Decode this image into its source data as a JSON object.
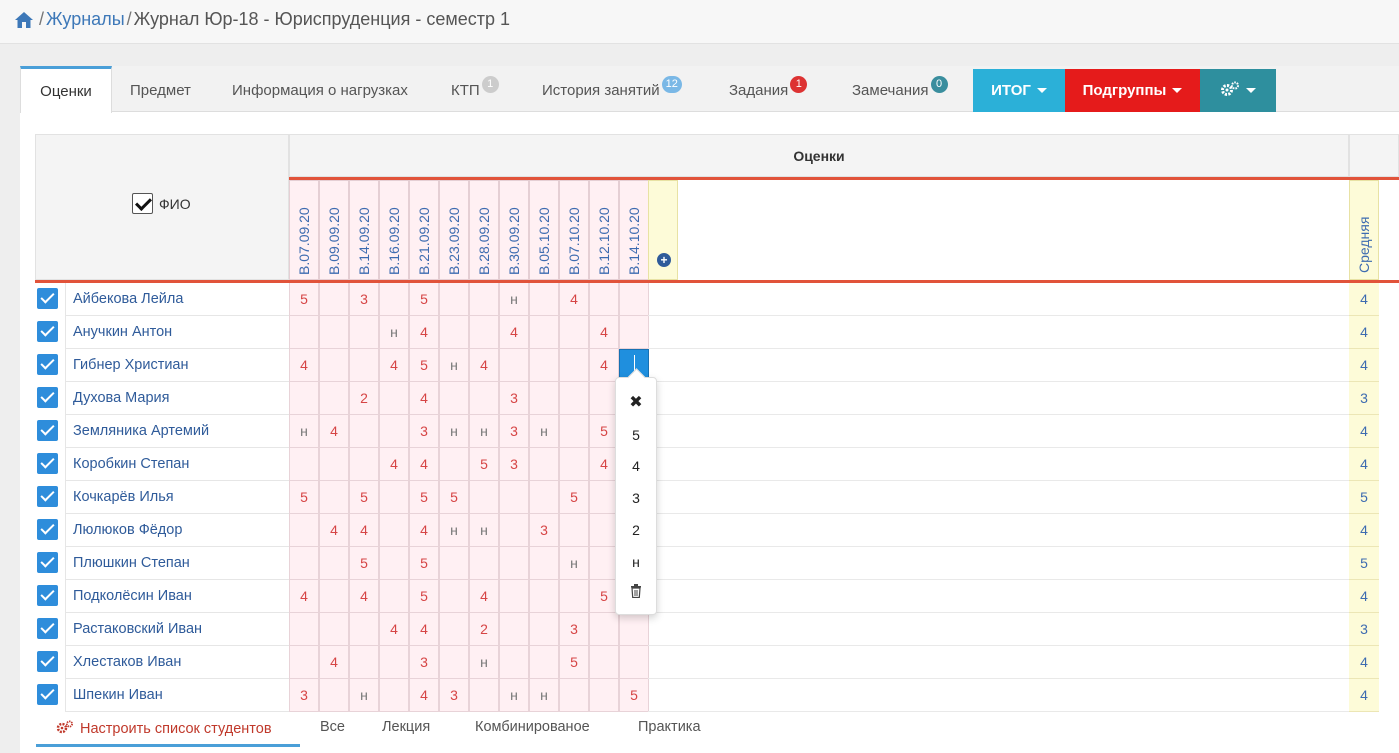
{
  "breadcrumb": {
    "home_icon": "home-icon",
    "journals": "Журналы",
    "current": "Журнал Юр-18 - Юриспруденция - семестр 1"
  },
  "tabs": [
    {
      "label": "Оценки",
      "active": true
    },
    {
      "label": "Предмет"
    },
    {
      "label": "Информация о нагрузках"
    },
    {
      "label": "КТП",
      "badge": "1",
      "badge_color": "#cccccc"
    },
    {
      "label": "История занятий",
      "badge": "12",
      "badge_color": "#7ab8e6"
    },
    {
      "label": "Задания",
      "badge": "1",
      "badge_color": "#dd3333"
    },
    {
      "label": "Замечания",
      "badge": "0",
      "badge_color": "#3a8e9e"
    }
  ],
  "buttons": {
    "itog": {
      "label": "ИТОГ",
      "color": "#2bb0d8"
    },
    "subgroups": {
      "label": "Подгруппы",
      "color": "#e51b1b"
    },
    "settings": {
      "icon": "gears-icon",
      "color": "#2e8f9e"
    }
  },
  "table": {
    "section_title": "Оценки",
    "fio_label": "ФИО",
    "dates": [
      "В.07.09.20",
      "В.09.09.20",
      "В.14.09.20",
      "В.16.09.20",
      "В.21.09.20",
      "В.23.09.20",
      "В.28.09.20",
      "В.30.09.20",
      "В.05.10.20",
      "В.07.10.20",
      "В.12.10.20",
      "В.14.10.20"
    ],
    "add_icon": "plus-circle-icon",
    "avg_label": "Средняя",
    "students": [
      {
        "name": "Айбекова Лейла",
        "marks": [
          "5",
          "",
          "3",
          "",
          "5",
          "",
          "",
          "н",
          "",
          "4",
          "",
          ""
        ],
        "avg": "4"
      },
      {
        "name": "Анучкин Антон",
        "marks": [
          "",
          "",
          "",
          "н",
          "4",
          "",
          "",
          "4",
          "",
          "",
          "4",
          ""
        ],
        "avg": "4"
      },
      {
        "name": "Гибнер Христиан",
        "marks": [
          "4",
          "",
          "",
          "4",
          "5",
          "н",
          "4",
          "",
          "",
          "",
          "4",
          ""
        ],
        "avg": "4"
      },
      {
        "name": "Духова Мария",
        "marks": [
          "",
          "",
          "2",
          "",
          "4",
          "",
          "",
          "3",
          "",
          "",
          "",
          ""
        ],
        "avg": "3"
      },
      {
        "name": "Земляника Артемий",
        "marks": [
          "н",
          "4",
          "",
          "",
          "3",
          "н",
          "н",
          "3",
          "н",
          "",
          "5",
          ""
        ],
        "avg": "4"
      },
      {
        "name": "Коробкин Степан",
        "marks": [
          "",
          "",
          "",
          "4",
          "4",
          "",
          "5",
          "3",
          "",
          "",
          "4",
          ""
        ],
        "avg": "4"
      },
      {
        "name": "Кочкарёв Илья",
        "marks": [
          "5",
          "",
          "5",
          "",
          "5",
          "5",
          "",
          "",
          "",
          "5",
          "",
          ""
        ],
        "avg": "5"
      },
      {
        "name": "Люлюков Фёдор",
        "marks": [
          "",
          "4",
          "4",
          "",
          "4",
          "н",
          "н",
          "",
          "3",
          "",
          "",
          ""
        ],
        "avg": "4"
      },
      {
        "name": "Плюшкин Степан",
        "marks": [
          "",
          "",
          "5",
          "",
          "5",
          "",
          "",
          "",
          "",
          "н",
          "",
          ""
        ],
        "avg": "5"
      },
      {
        "name": "Подколёсин Иван",
        "marks": [
          "4",
          "",
          "4",
          "",
          "5",
          "",
          "4",
          "",
          "",
          "",
          "5",
          ""
        ],
        "avg": "4"
      },
      {
        "name": "Растаковский Иван",
        "marks": [
          "",
          "",
          "",
          "4",
          "4",
          "",
          "2",
          "",
          "",
          "3",
          "",
          ""
        ],
        "avg": "3"
      },
      {
        "name": "Хлестаков Иван",
        "marks": [
          "",
          "4",
          "",
          "",
          "3",
          "",
          "н",
          "",
          "",
          "5",
          "",
          ""
        ],
        "avg": "4"
      },
      {
        "name": "Шпекин Иван",
        "marks": [
          "3",
          "",
          "н",
          "",
          "4",
          "3",
          "",
          "н",
          "н",
          "",
          "",
          "5"
        ],
        "avg": "4"
      }
    ],
    "selected_cell": {
      "row": 2,
      "col": 11
    }
  },
  "popup": {
    "close_icon": "close-icon",
    "options": [
      "5",
      "4",
      "3",
      "2",
      "н"
    ],
    "delete_icon": "trash-icon"
  },
  "footer": {
    "configure_label": "Настроить список студентов",
    "configure_icon": "gears-icon",
    "filters": [
      "Все",
      "Лекция",
      "Комбинированое",
      "Практика"
    ]
  }
}
